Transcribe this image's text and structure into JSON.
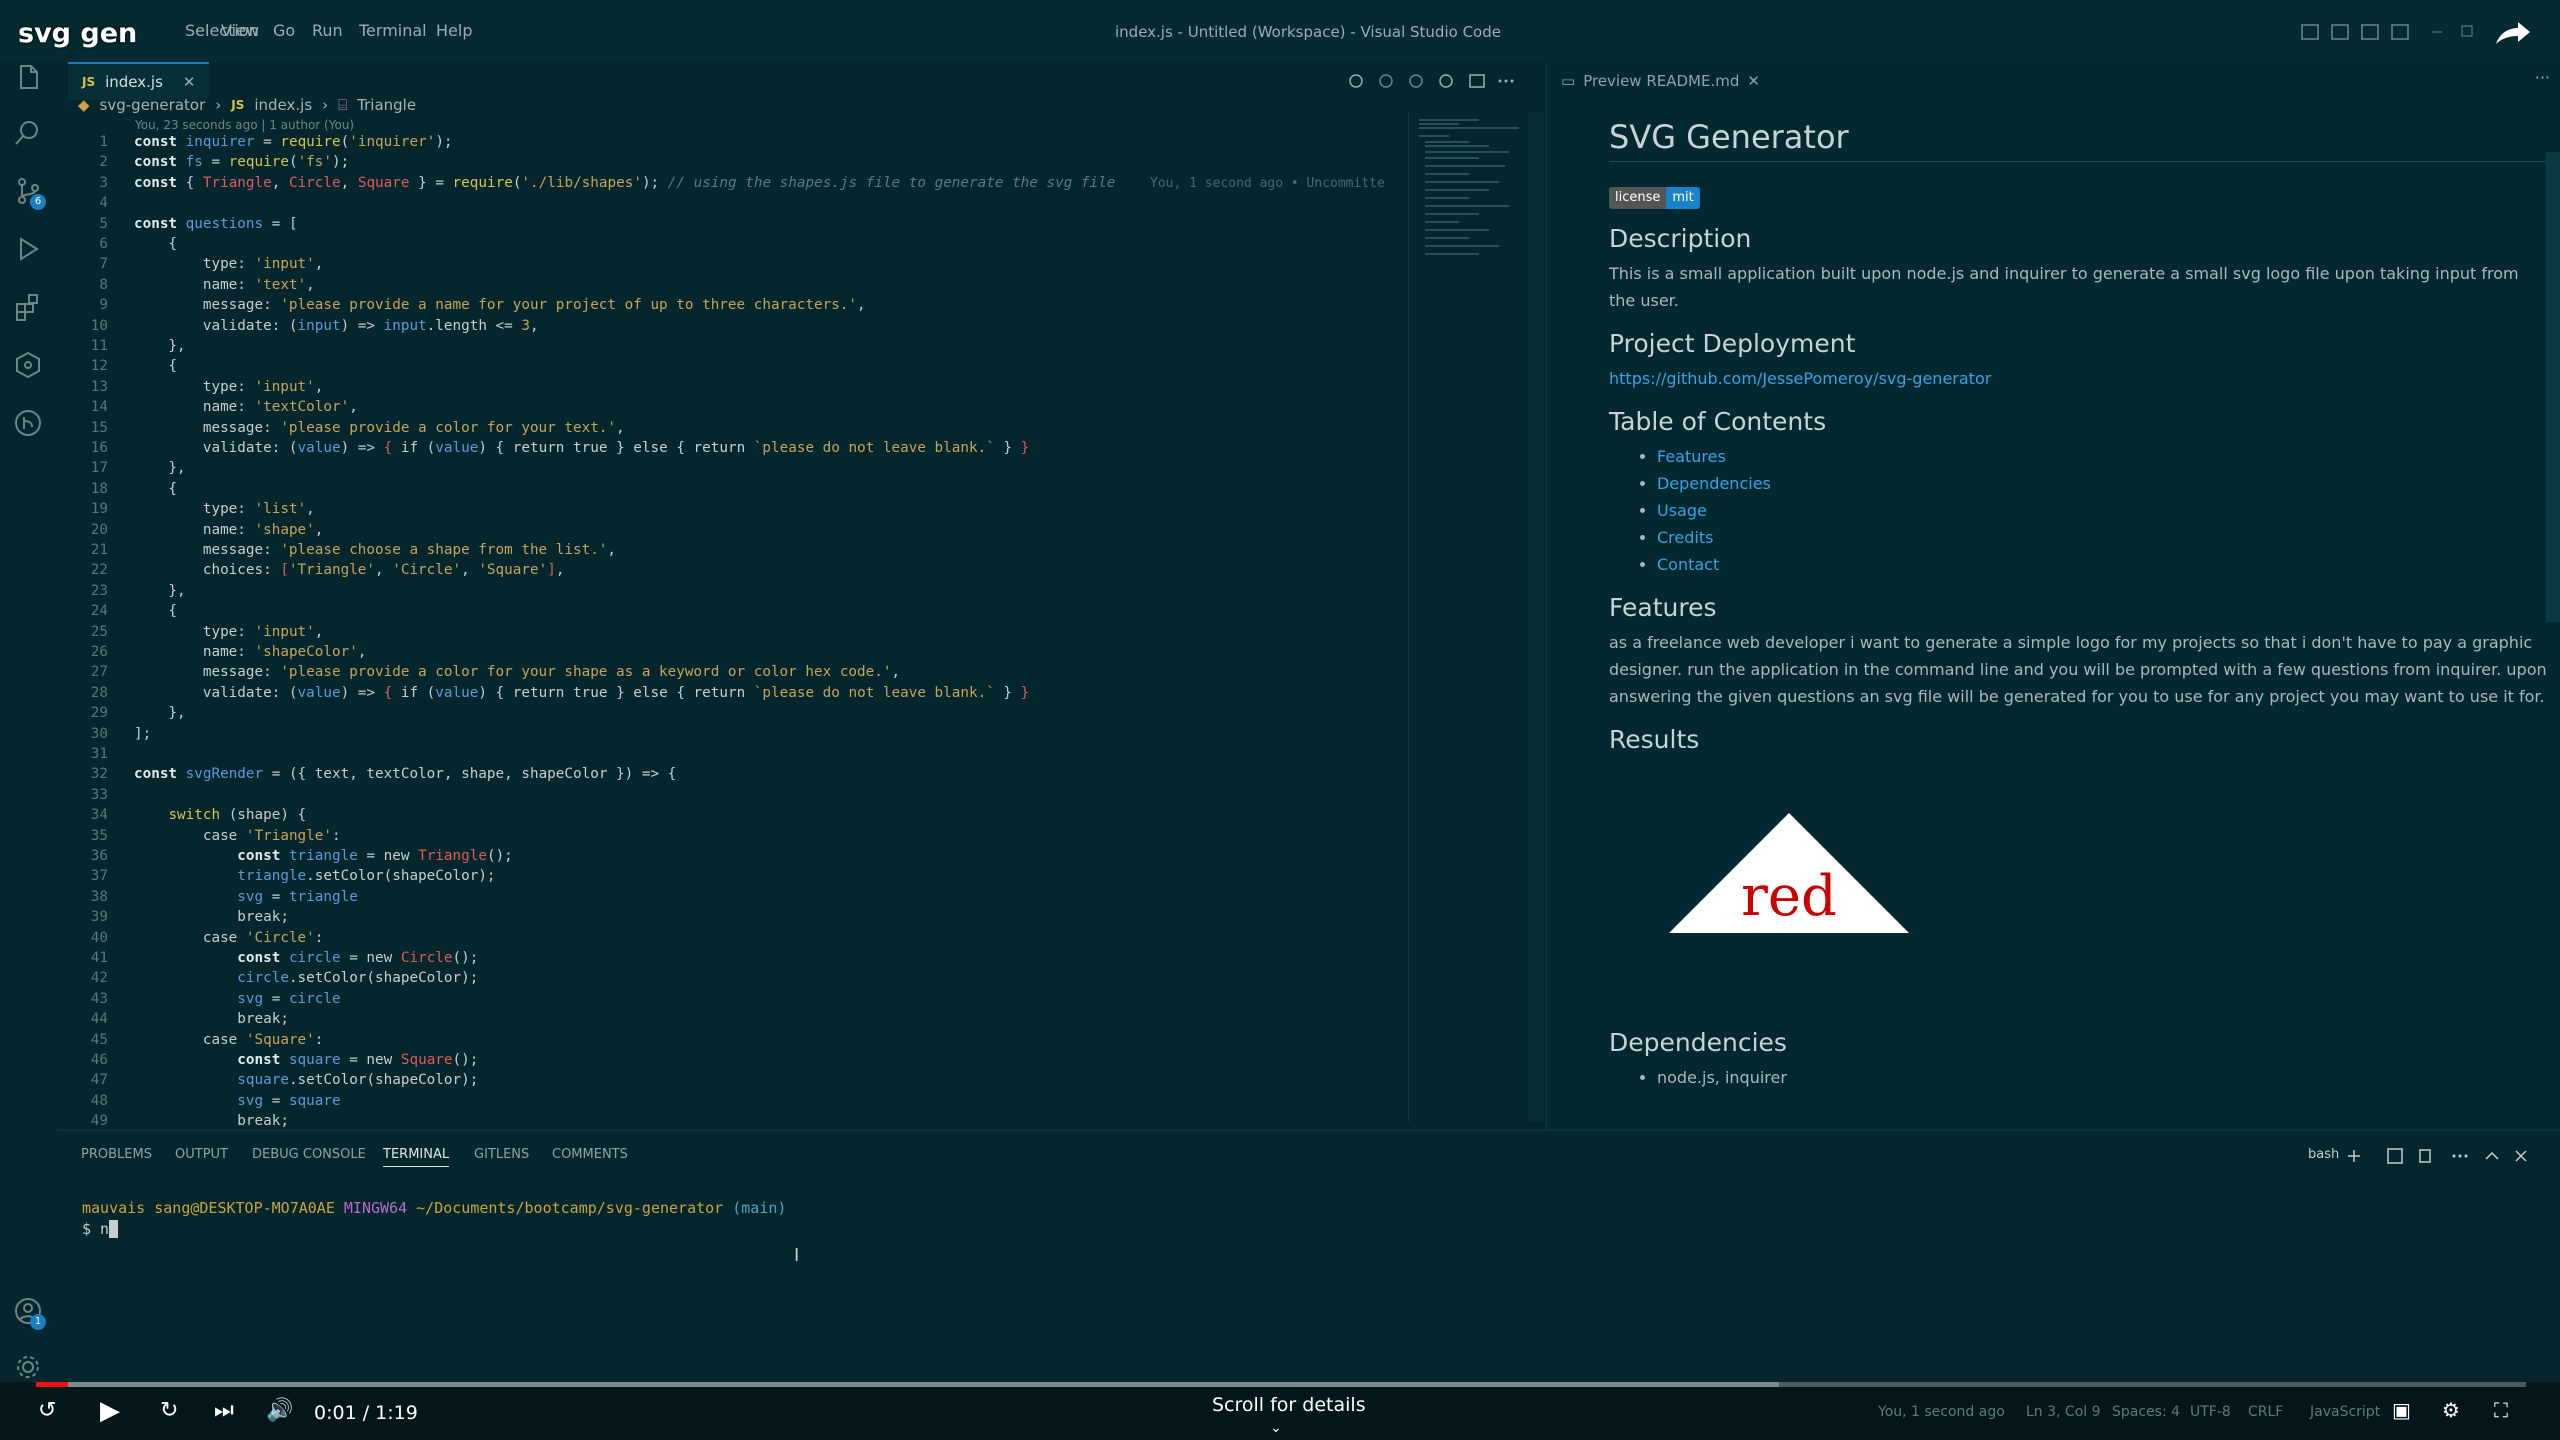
{
  "video_title": "svg gen",
  "window_title": "index.js - Untitled (Workspace) - Visual Studio Code",
  "menu": [
    "Selection",
    "View",
    "Go",
    "Run",
    "Terminal",
    "Help"
  ],
  "tab": {
    "icon": "JS",
    "label": "index.js"
  },
  "breadcrumb": {
    "folder": "svg-generator",
    "file": "index.js",
    "symbol": "Triangle"
  },
  "blame_top": "You, 23 seconds ago | 1 author (You)",
  "inline_blame": "You, 1 second ago • Uncommitte",
  "badges": {
    "source_control": "6",
    "accounts": "1"
  },
  "code_lines": [
    [
      [
        "k",
        "const "
      ],
      [
        "v",
        "inquirer"
      ],
      [
        "p",
        " = "
      ],
      [
        "y",
        "require"
      ],
      [
        "p",
        "("
      ],
      [
        "s",
        "'inquirer'"
      ],
      [
        "p",
        ");"
      ]
    ],
    [
      [
        "k",
        "const "
      ],
      [
        "v",
        "fs"
      ],
      [
        "p",
        " = "
      ],
      [
        "y",
        "require"
      ],
      [
        "p",
        "("
      ],
      [
        "s",
        "'fs'"
      ],
      [
        "p",
        ");"
      ]
    ],
    [
      [
        "k",
        "const "
      ],
      [
        "p",
        "{ "
      ],
      [
        "r",
        "Triangle"
      ],
      [
        "p",
        ", "
      ],
      [
        "r",
        "Circle"
      ],
      [
        "p",
        ", "
      ],
      [
        "r",
        "Square"
      ],
      [
        "p",
        " } = "
      ],
      [
        "y",
        "require"
      ],
      [
        "p",
        "("
      ],
      [
        "s",
        "'./lib/shapes'"
      ],
      [
        "p",
        "); "
      ],
      [
        "c",
        "// using the shapes.js file to generate the svg file"
      ]
    ],
    [],
    [
      [
        "k",
        "const "
      ],
      [
        "v",
        "questions"
      ],
      [
        "p",
        " = ["
      ]
    ],
    [
      [
        "p",
        "    {"
      ]
    ],
    [
      [
        "p",
        "        type: "
      ],
      [
        "s",
        "'input'"
      ],
      [
        "p",
        ","
      ]
    ],
    [
      [
        "p",
        "        name: "
      ],
      [
        "s",
        "'text'"
      ],
      [
        "p",
        ","
      ]
    ],
    [
      [
        "p",
        "        message: "
      ],
      [
        "s",
        "'please provide a name for your project of up to three characters.'"
      ],
      [
        "p",
        ","
      ]
    ],
    [
      [
        "p",
        "        validate: ("
      ],
      [
        "v",
        "input"
      ],
      [
        "p",
        ") => "
      ],
      [
        "v",
        "input"
      ],
      [
        "p",
        ".length <= "
      ],
      [
        "s",
        "3"
      ],
      [
        "p",
        ","
      ]
    ],
    [
      [
        "p",
        "    },"
      ]
    ],
    [
      [
        "p",
        "    {"
      ]
    ],
    [
      [
        "p",
        "        type: "
      ],
      [
        "s",
        "'input'"
      ],
      [
        "p",
        ","
      ]
    ],
    [
      [
        "p",
        "        name: "
      ],
      [
        "s",
        "'textColor'"
      ],
      [
        "p",
        ","
      ]
    ],
    [
      [
        "p",
        "        message: "
      ],
      [
        "s",
        "'please provide a color for your text.'"
      ],
      [
        "p",
        ","
      ]
    ],
    [
      [
        "p",
        "        validate: ("
      ],
      [
        "v",
        "value"
      ],
      [
        "p",
        ") => "
      ],
      [
        "r",
        "{ "
      ],
      [
        "p",
        "if ("
      ],
      [
        "v",
        "value"
      ],
      [
        "p",
        ") { return true } else { return "
      ],
      [
        "s",
        "`please do not leave blank.`"
      ],
      [
        "p",
        " } "
      ],
      [
        "r",
        "}"
      ]
    ],
    [
      [
        "p",
        "    },"
      ]
    ],
    [
      [
        "p",
        "    {"
      ]
    ],
    [
      [
        "p",
        "        type: "
      ],
      [
        "s",
        "'list'"
      ],
      [
        "p",
        ","
      ]
    ],
    [
      [
        "p",
        "        name: "
      ],
      [
        "s",
        "'shape'"
      ],
      [
        "p",
        ","
      ]
    ],
    [
      [
        "p",
        "        message: "
      ],
      [
        "s",
        "'please choose a shape from the list.'"
      ],
      [
        "p",
        ","
      ]
    ],
    [
      [
        "p",
        "        choices: "
      ],
      [
        "r",
        "["
      ],
      [
        "s",
        "'Triangle'"
      ],
      [
        "p",
        ", "
      ],
      [
        "s",
        "'Circle'"
      ],
      [
        "p",
        ", "
      ],
      [
        "s",
        "'Square'"
      ],
      [
        "r",
        "]"
      ],
      [
        "p",
        ","
      ]
    ],
    [
      [
        "p",
        "    },"
      ]
    ],
    [
      [
        "p",
        "    {"
      ]
    ],
    [
      [
        "p",
        "        type: "
      ],
      [
        "s",
        "'input'"
      ],
      [
        "p",
        ","
      ]
    ],
    [
      [
        "p",
        "        name: "
      ],
      [
        "s",
        "'shapeColor'"
      ],
      [
        "p",
        ","
      ]
    ],
    [
      [
        "p",
        "        message: "
      ],
      [
        "s",
        "'please provide a color for your shape as a keyword or color hex code.'"
      ],
      [
        "p",
        ","
      ]
    ],
    [
      [
        "p",
        "        validate: ("
      ],
      [
        "v",
        "value"
      ],
      [
        "p",
        ") => "
      ],
      [
        "r",
        "{ "
      ],
      [
        "p",
        "if ("
      ],
      [
        "v",
        "value"
      ],
      [
        "p",
        ") { return true } else { return "
      ],
      [
        "s",
        "`please do not leave blank.`"
      ],
      [
        "p",
        " } "
      ],
      [
        "r",
        "}"
      ]
    ],
    [
      [
        "p",
        "    },"
      ]
    ],
    [
      [
        "p",
        "];"
      ]
    ],
    [],
    [
      [
        "k",
        "const "
      ],
      [
        "v",
        "svgRender"
      ],
      [
        "p",
        " = ({ text, textColor, shape, shapeColor }) => {"
      ]
    ],
    [],
    [
      [
        "p",
        "    "
      ],
      [
        "y",
        "switch"
      ],
      [
        "p",
        " (shape) {"
      ]
    ],
    [
      [
        "p",
        "        case "
      ],
      [
        "s",
        "'Triangle'"
      ],
      [
        "p",
        ":"
      ]
    ],
    [
      [
        "p",
        "            "
      ],
      [
        "k",
        "const "
      ],
      [
        "v",
        "triangle"
      ],
      [
        "p",
        " = new "
      ],
      [
        "r",
        "Triangle"
      ],
      [
        "p",
        "();"
      ]
    ],
    [
      [
        "p",
        "            "
      ],
      [
        "v",
        "triangle"
      ],
      [
        "p",
        ".setColor(shapeColor);"
      ]
    ],
    [
      [
        "p",
        "            "
      ],
      [
        "v",
        "svg"
      ],
      [
        "p",
        " = "
      ],
      [
        "v",
        "triangle"
      ]
    ],
    [
      [
        "p",
        "            break;"
      ]
    ],
    [
      [
        "p",
        "        case "
      ],
      [
        "s",
        "'Circle'"
      ],
      [
        "p",
        ":"
      ]
    ],
    [
      [
        "p",
        "            "
      ],
      [
        "k",
        "const "
      ],
      [
        "v",
        "circle"
      ],
      [
        "p",
        " = new "
      ],
      [
        "r",
        "Circle"
      ],
      [
        "p",
        "();"
      ]
    ],
    [
      [
        "p",
        "            "
      ],
      [
        "v",
        "circle"
      ],
      [
        "p",
        ".setColor(shapeColor);"
      ]
    ],
    [
      [
        "p",
        "            "
      ],
      [
        "v",
        "svg"
      ],
      [
        "p",
        " = "
      ],
      [
        "v",
        "circle"
      ]
    ],
    [
      [
        "p",
        "            break;"
      ]
    ],
    [
      [
        "p",
        "        case "
      ],
      [
        "s",
        "'Square'"
      ],
      [
        "p",
        ":"
      ]
    ],
    [
      [
        "p",
        "            "
      ],
      [
        "k",
        "const "
      ],
      [
        "v",
        "square"
      ],
      [
        "p",
        " = new "
      ],
      [
        "r",
        "Square"
      ],
      [
        "p",
        "();"
      ]
    ],
    [
      [
        "p",
        "            "
      ],
      [
        "v",
        "square"
      ],
      [
        "p",
        ".setColor(shapeColor);"
      ]
    ],
    [
      [
        "p",
        "            "
      ],
      [
        "v",
        "svg"
      ],
      [
        "p",
        " = "
      ],
      [
        "v",
        "square"
      ]
    ],
    [
      [
        "p",
        "            break;"
      ]
    ]
  ],
  "preview": {
    "tab_label": "Preview README.md",
    "title": "SVG Generator",
    "license_label": "license",
    "license_value": "mit",
    "description_heading": "Description",
    "description": "This is a small application built upon node.js and inquirer to generate a small svg logo file upon taking input from the user.",
    "deployment_heading": "Project Deployment",
    "deployment_link": "https://github.com/JessePomeroy/svg-generator",
    "toc_heading": "Table of Contents",
    "toc": [
      "Features",
      "Dependencies",
      "Usage",
      "Credits",
      "Contact"
    ],
    "features_heading": "Features",
    "features": "as a freelance web developer i want to generate a simple logo for my projects so that i don't have to pay a graphic designer. run the application in the command line and you will be prompted with a few questions from inquirer. upon answering the given questions an svg file will be generated for you to use for any project you may want to use it for.",
    "results_heading": "Results",
    "result_svg_text": "red",
    "dependencies_heading": "Dependencies",
    "dependencies": [
      "node.js, inquirer"
    ]
  },
  "panel": {
    "tabs": [
      "PROBLEMS",
      "OUTPUT",
      "DEBUG CONSOLE",
      "TERMINAL",
      "GITLENS",
      "COMMENTS"
    ],
    "shell": "bash",
    "prompt_user": "mauvais sang@DESKTOP-MO7A0AE",
    "prompt_env": "MINGW64",
    "prompt_path": "~/Documents/bootcamp/svg-generator",
    "prompt_branch": "(main)",
    "input_line": "$ n"
  },
  "player": {
    "time": "0:01 / 1:19",
    "scroll_hint": "Scroll for details",
    "played_fraction": 0.013,
    "buffered_fraction": 0.7
  },
  "status": {
    "blame": "You, 1 second ago",
    "position": "Ln 3, Col 9",
    "spaces": "Spaces: 4",
    "encoding": "UTF-8",
    "eol": "CRLF",
    "language": "JavaScript"
  }
}
